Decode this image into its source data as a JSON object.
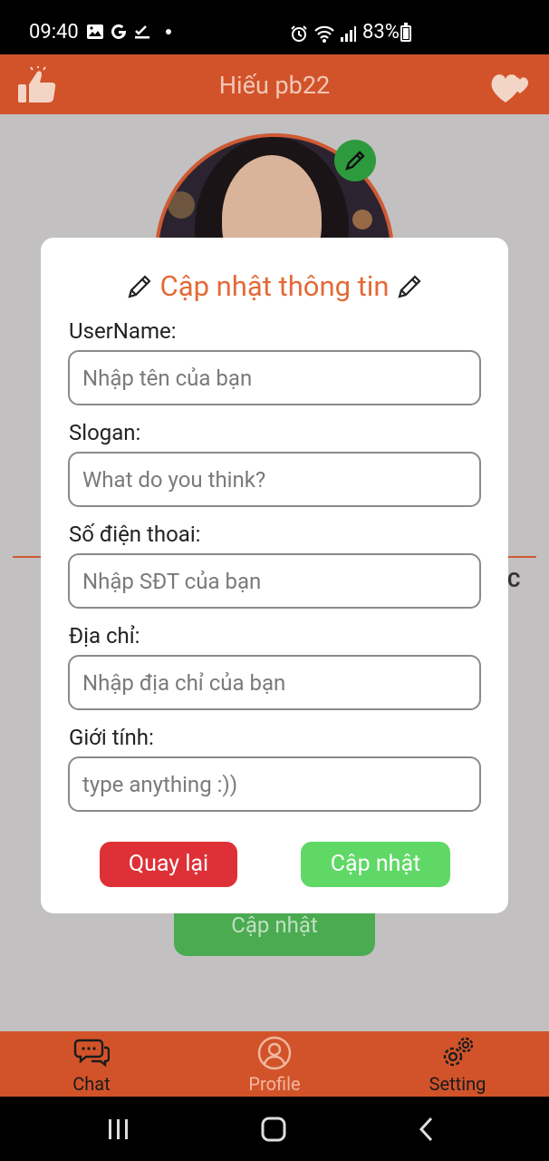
{
  "status_bar": {
    "time": "09:40",
    "battery": "83%",
    "battery_level": 0.83
  },
  "app_bar": {
    "title": "Hiếu pb22"
  },
  "background": {
    "peek_text": "C",
    "update_button_label": "Cập nhật"
  },
  "modal": {
    "title": "Cập nhật thông tin",
    "fields": [
      {
        "label": "UserName:",
        "placeholder": "Nhập tên của bạn",
        "value": ""
      },
      {
        "label": "Slogan:",
        "placeholder": "What do you think?",
        "value": ""
      },
      {
        "label": "Số điện thoai:",
        "placeholder": "Nhập SĐT của bạn",
        "value": ""
      },
      {
        "label": "Địa chỉ:",
        "placeholder": "Nhập địa chỉ của bạn",
        "value": ""
      },
      {
        "label": "Giới tính:",
        "placeholder": "type anything :))",
        "value": ""
      }
    ],
    "back_button": "Quay lại",
    "update_button": "Cập nhật"
  },
  "bottom_nav": {
    "items": [
      {
        "label": "Chat",
        "icon": "chat-bubbles-icon"
      },
      {
        "label": "Profile",
        "icon": "user-circle-icon"
      },
      {
        "label": "Setting",
        "icon": "gears-icon"
      }
    ]
  },
  "colors": {
    "accent": "#d2532a",
    "title_orange": "#e36a37",
    "danger": "#dd3137",
    "success": "#5fd866"
  }
}
